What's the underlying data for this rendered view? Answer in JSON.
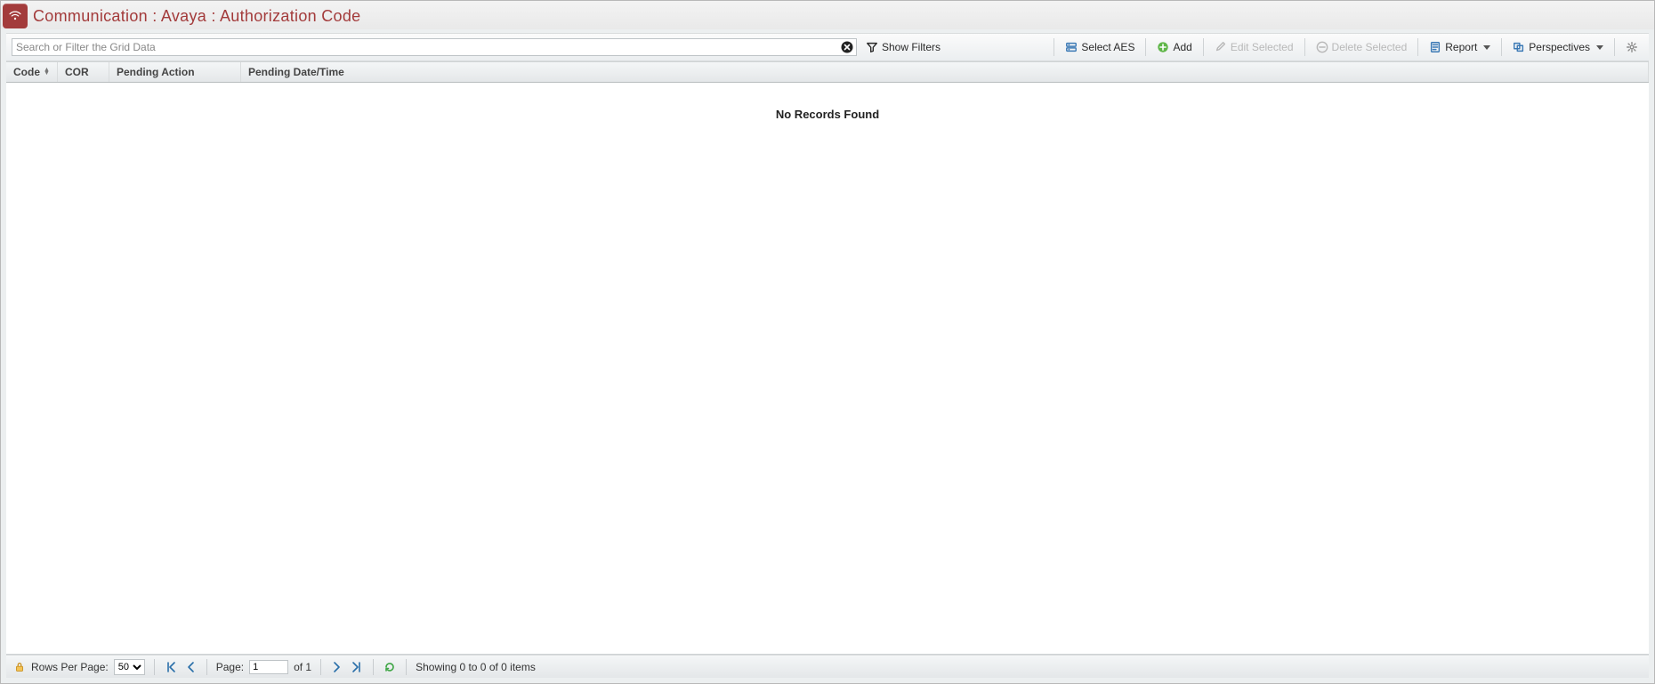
{
  "title": "Communication : Avaya : Authorization Code",
  "toolbar": {
    "search_placeholder": "Search or Filter the Grid Data",
    "search_value": "",
    "show_filters": "Show Filters",
    "select_aes": "Select AES",
    "add": "Add",
    "edit_selected": "Edit Selected",
    "delete_selected": "Delete Selected",
    "report": "Report",
    "perspectives": "Perspectives"
  },
  "grid": {
    "columns": {
      "code": "Code",
      "cor": "COR",
      "pending_action": "Pending Action",
      "pending_date": "Pending Date/Time"
    },
    "no_records": "No Records Found"
  },
  "pager": {
    "rows_per_page_label": "Rows Per Page:",
    "rows_per_page_value": "50",
    "page_label": "Page:",
    "page_value": "1",
    "of_text": "of 1",
    "summary": "Showing 0 to 0 of 0 items"
  }
}
